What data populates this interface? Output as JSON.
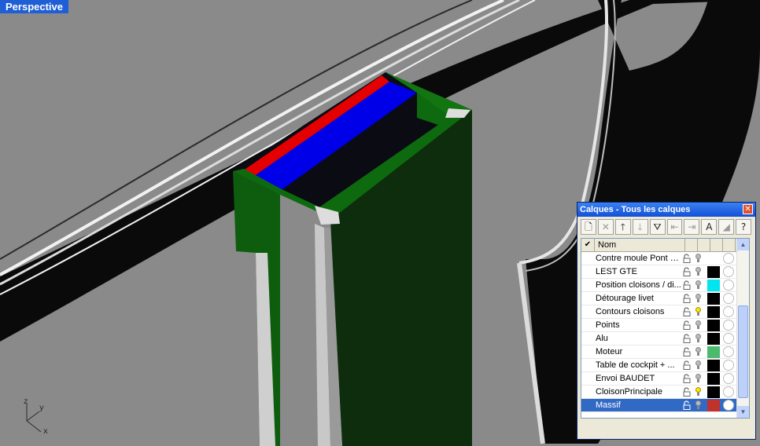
{
  "viewport": {
    "label": "Perspective",
    "axes": {
      "z": "z",
      "y": "y",
      "x": "x"
    }
  },
  "layers_panel": {
    "title": "Calques - Tous les calques",
    "toolbar": [
      {
        "name": "new-layer",
        "glyph": "🗋",
        "enabled": true
      },
      {
        "name": "delete-layer",
        "glyph": "✕",
        "enabled": false
      },
      {
        "name": "move-up",
        "glyph": "🡑",
        "enabled": true
      },
      {
        "name": "move-down",
        "glyph": "🡓",
        "enabled": false
      },
      {
        "name": "filter",
        "glyph": "⛛",
        "enabled": true
      },
      {
        "name": "import",
        "glyph": "⇤",
        "enabled": false
      },
      {
        "name": "export",
        "glyph": "⇥",
        "enabled": false
      },
      {
        "name": "font",
        "glyph": "A",
        "enabled": true
      },
      {
        "name": "color",
        "glyph": "◢",
        "enabled": false
      },
      {
        "name": "help",
        "glyph": "?",
        "enabled": true
      }
    ],
    "header": {
      "check": "✔",
      "name": "Nom"
    },
    "layers": [
      {
        "name": "Contre moule Pont u...",
        "bulb_on": false,
        "color": "#ffffff"
      },
      {
        "name": "LEST GTE",
        "bulb_on": false,
        "color": "#000000"
      },
      {
        "name": "Position cloisons / di...",
        "bulb_on": false,
        "color": "#00e5ee"
      },
      {
        "name": "Détourage livet",
        "bulb_on": false,
        "color": "#000000"
      },
      {
        "name": "Contours cloisons",
        "bulb_on": true,
        "color": "#000000"
      },
      {
        "name": "Points",
        "bulb_on": false,
        "color": "#000000"
      },
      {
        "name": "Alu",
        "bulb_on": false,
        "color": "#000000"
      },
      {
        "name": "Moteur",
        "bulb_on": false,
        "color": "#4cba6e"
      },
      {
        "name": "Table de cockpit + ...",
        "bulb_on": false,
        "color": "#000000"
      },
      {
        "name": "Envoi BAUDET",
        "bulb_on": false,
        "color": "#000000"
      },
      {
        "name": "CloisonPrincipale",
        "bulb_on": true,
        "color": "#000000"
      },
      {
        "name": "Massif",
        "bulb_on": false,
        "color": "#c0322e",
        "selected": true
      }
    ]
  }
}
